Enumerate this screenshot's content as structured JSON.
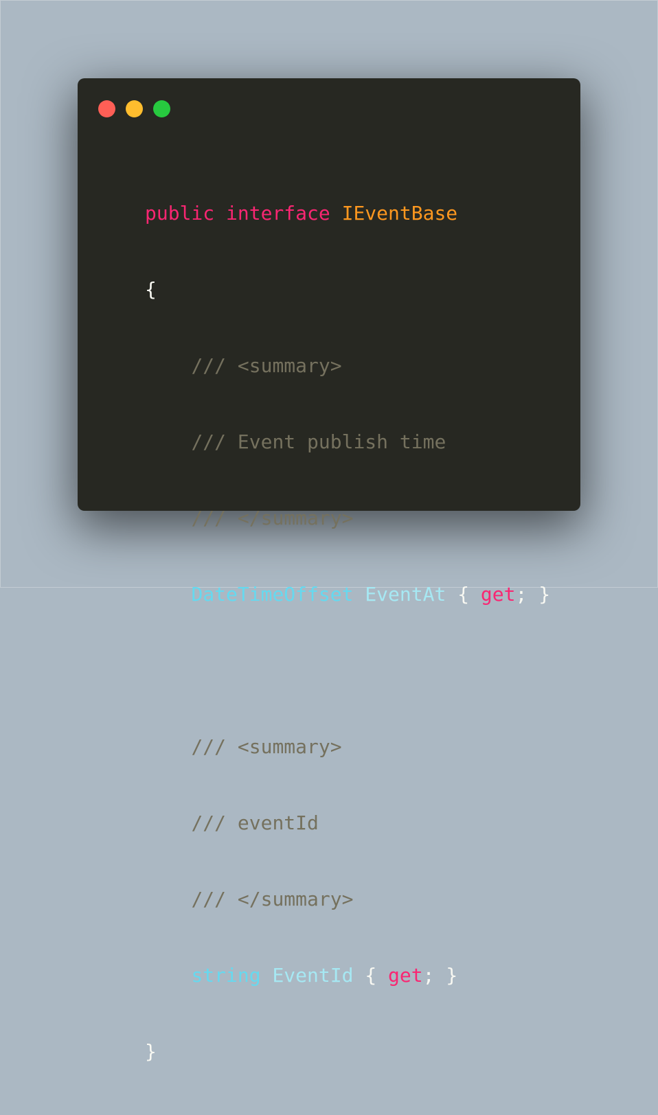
{
  "window": {
    "controls": {
      "close_color": "#ff5f56",
      "minimize_color": "#ffbd2e",
      "maximize_color": "#27c93f"
    }
  },
  "code": {
    "kw_public": "public",
    "kw_interface": "interface",
    "interface_name": "IEventBase",
    "open_brace": "{",
    "doc1_open": "/// <summary>",
    "doc1_text": "/// Event publish time",
    "doc1_close": "/// </summary>",
    "prop1_type": "DateTimeOffset",
    "prop1_name": "EventAt",
    "prop1_open": "{",
    "prop1_get": "get",
    "prop1_close": "; }",
    "doc2_open": "/// <summary>",
    "doc2_text": "/// eventId",
    "doc2_close": "/// </summary>",
    "prop2_type": "string",
    "prop2_name": "EventId",
    "prop2_open": "{",
    "prop2_get": "get",
    "prop2_close": "; }",
    "close_brace": "}"
  },
  "colors": {
    "background": "#abb8c3",
    "editor_bg": "#272822",
    "keyword": "#f92672",
    "type": "#66d9ef",
    "class_name": "#fd971f",
    "comment": "#75715e",
    "text": "#f8f8f2"
  }
}
